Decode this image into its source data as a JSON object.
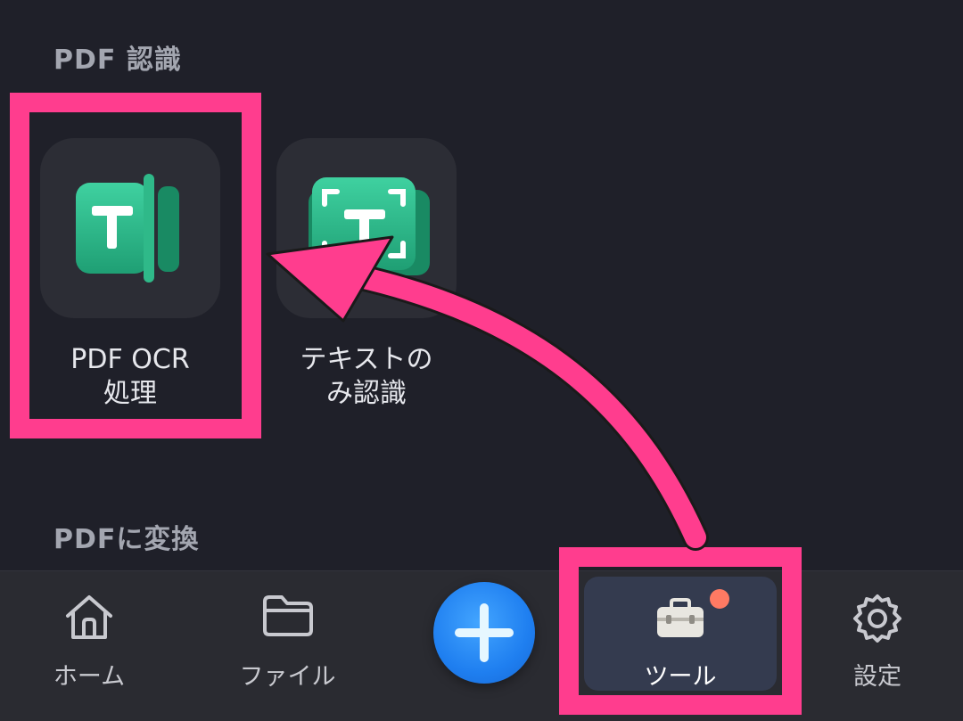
{
  "sections": {
    "pdf_recognition": "PDF 認識",
    "convert_to_pdf": "PDFに変換"
  },
  "tools": [
    {
      "line1": "PDF OCR",
      "line2": "処理",
      "icon": "ocr-book-t-icon"
    },
    {
      "line1": "テキストの",
      "line2": "み認識",
      "icon": "text-scan-t-icon"
    }
  ],
  "nav": {
    "home": "ホーム",
    "files": "ファイル",
    "add": "add",
    "tools": "ツール",
    "settings": "設定"
  },
  "colors": {
    "background": "#1f2029",
    "card": "#2c2d35",
    "icon_green": "#2fb989",
    "accent_blue": "#1f7ff0",
    "highlight_pink": "#ff3d8e",
    "notification_dot": "#ff7a63"
  }
}
